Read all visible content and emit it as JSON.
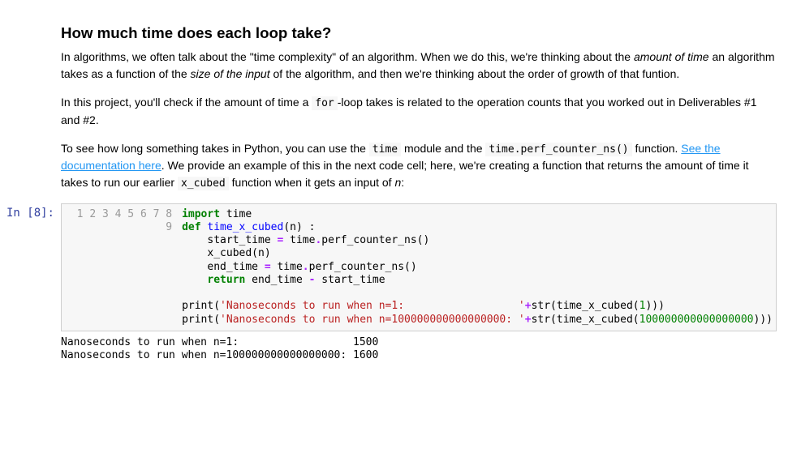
{
  "heading": "How much time does each loop take?",
  "para1_a": "In algorithms, we often talk about the \"time complexity\" of an algorithm. When we do this, we're thinking about the ",
  "para1_em1": "amount of time",
  "para1_b": " an algorithm takes as a function of the ",
  "para1_em2": "size of the input",
  "para1_c": " of the algorithm, and then we're thinking about the order of growth of that funtion.",
  "para2_a": "In this project, you'll check if the amount of time a ",
  "para2_code1": "for",
  "para2_b": "-loop takes is related to the operation counts that you worked out in Deliverables #1 and #2.",
  "para3_a": "To see how long something takes in Python, you can use the ",
  "para3_code1": "time",
  "para3_b": " module and the ",
  "para3_code2": "time.perf_counter_ns()",
  "para3_c": " function. ",
  "para3_link": "See the documentation here",
  "para3_d": ". We provide an example of this in the next code cell; here, we're creating a function that returns the amount of time it takes to run our earlier ",
  "para3_code3": "x_cubed",
  "para3_e": " function when it gets an input of ",
  "para3_em1": "n",
  "para3_f": ":",
  "prompt_label": "In [8]:",
  "gutter": [
    "1",
    "2",
    "3",
    "4",
    "5",
    "6",
    "7",
    "8",
    "9"
  ],
  "code": {
    "l1_kw": "import",
    "l1_rest": " time",
    "l2_kw": "def",
    "l2_fn": " time_x_cubed",
    "l2_rest": "(n) :",
    "l3_a": "    start_time ",
    "l3_op": "=",
    "l3_b": " time",
    "l3_op2": ".",
    "l3_c": "perf_counter_ns()",
    "l4_a": "    x_cubed(n)",
    "l5_a": "    end_time ",
    "l5_op": "=",
    "l5_b": " time",
    "l5_op2": ".",
    "l5_c": "perf_counter_ns()",
    "l6_kw": "    return",
    "l6_a": " end_time ",
    "l6_op": "-",
    "l6_b": " start_time",
    "l8_a": "print(",
    "l8_str": "'Nanoseconds to run when n=1:                  '",
    "l8_op": "+",
    "l8_b": "str(time_x_cubed(",
    "l8_num": "1",
    "l8_c": ")))",
    "l9_a": "print(",
    "l9_str": "'Nanoseconds to run when n=100000000000000000: '",
    "l9_op": "+",
    "l9_b": "str(time_x_cubed(",
    "l9_num": "100000000000000000",
    "l9_c": ")))"
  },
  "output_line1": "Nanoseconds to run when n=1:                  1500",
  "output_line2": "Nanoseconds to run when n=100000000000000000: 1600"
}
